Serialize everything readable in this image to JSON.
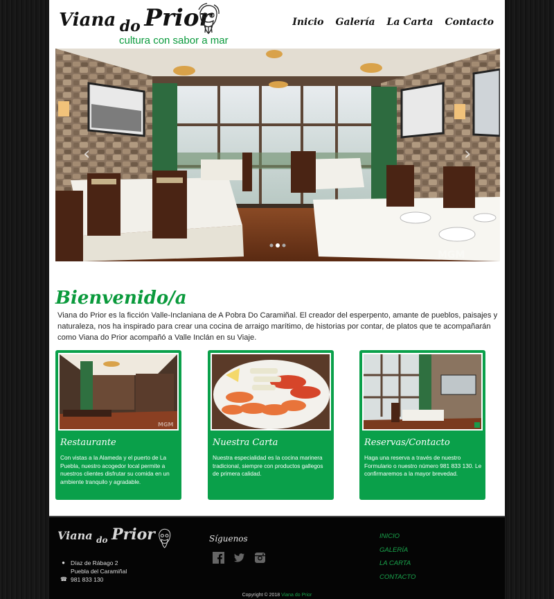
{
  "header": {
    "logo_word1": "Viana",
    "logo_word2": "do",
    "logo_word3": "Prior",
    "tagline": "cultura con sabor a mar",
    "nav": [
      "Inicio",
      "Galería",
      "La Carta",
      "Contacto"
    ]
  },
  "slider": {
    "slide_count": 3,
    "active_slide": 2,
    "watermark": "MGM"
  },
  "welcome": {
    "title": "Bienvenido/a",
    "text": "Viana do Prior es la ficción Valle-Inclaniana de A Pobra Do Caramiñal. El creador del esperpento, amante de pueblos, paisajes y naturaleza, nos ha inspirado para crear una cocina de arraigo marítimo, de historias por contar, de platos que te acompañarán como Viana do Prior acompañó a Valle Inclán en su Viaje."
  },
  "cards": [
    {
      "title": "Restaurante",
      "text": "Con vistas a la Alameda y el puerto de La Puebla, nuestro acogedor local permite a nuestros clientes disfrutar su comida en un ambiente tranquilo y agradable."
    },
    {
      "title": "Nuestra Carta",
      "text": "Nuestra especialidad es la cocina marinera tradicional, siempre con productos gallegos de primera calidad."
    },
    {
      "title": "Reservas/Contacto",
      "text": "Haga una reserva a través de nuestro Formulario o nuestro número 981 833 130. Le confirmaremos a la mayor brevedad."
    }
  ],
  "footer": {
    "address_line1": "Díaz de Rábago 2",
    "address_line2": "Puebla del Caramiñal",
    "phone": "981 833 130",
    "follow_label": "Síguenos",
    "social": [
      "facebook",
      "twitter",
      "instagram"
    ],
    "links": [
      "INICIO",
      "GALERÍA",
      "LA CARTA",
      "CONTACTO"
    ],
    "copyright_prefix": "Copyright © 2018",
    "copyright_name": "Viana do Prior"
  },
  "colors": {
    "accent": "#0aa04a",
    "heading_green": "#0a9a3c",
    "footer_bg": "#050505"
  }
}
